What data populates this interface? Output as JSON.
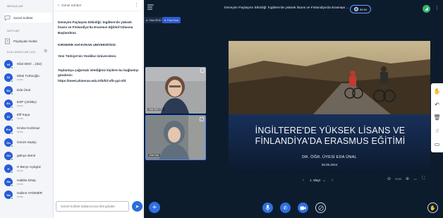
{
  "sidebar": {
    "messages_title": "MESAJLAR",
    "public_chat": "Genel Sohbet",
    "notes_title": "NOTLAR",
    "shared_notes": "Paylaşılan Notlar",
    "users_title": "KULLANICILAR (10)",
    "users": [
      {
        "initials": "Hi",
        "name": "Hilal SEKİ ...(Siz)",
        "sub": ""
      },
      {
        "initials": "Di",
        "name": "Dilek Tufracığlu",
        "sub": "MOBIL"
      },
      {
        "initials": "Ed",
        "name": "Eda Ünal",
        "sub": ""
      },
      {
        "initials": "Es",
        "name": "ESP Çimlökçi",
        "sub": "MOBIL"
      },
      {
        "initials": "El",
        "name": "Elif Kaya",
        "sub": "MOBIL"
      },
      {
        "initials": "Em",
        "name": "Emine Korkmaz",
        "sub": "MOBIL"
      },
      {
        "initials": "Gu",
        "name": "Gonze Saatçi",
        "sub": ""
      },
      {
        "initials": "Gü",
        "name": "gülnçe demir",
        "sub": ""
      },
      {
        "initials": "H",
        "name": "H Berçe Açıkgöz",
        "sub": "MOBIL"
      },
      {
        "initials": "Ha",
        "name": "Habibe Ertaş",
        "sub": "MOBIL"
      },
      {
        "initials": "Ha",
        "name": "Halime AYDEMİR",
        "sub": "MOBIL"
      }
    ]
  },
  "chat": {
    "title": "Genel Sohbet",
    "welcome_line1": "Deneyim Paylaşımı Etkinliği: İngiltere'de yüksek lisans ve Finlandiya'da Erasmus Eğitimi'Odasına Başlandınız.",
    "welcome_line2": "KIRSEHİR AHİ EVRAN UNİVERSİTESİ.",
    "welcome_line3": "Yeni Türkiye'nin Yenilikci Üniversitesi.",
    "invite_text": "Toplantıya çağırmak istediğiniz kişilere bu bağlantıyı gönderin:",
    "invite_link": "https://meet.ahievran.edu.tr/b/hil-ofb-ypi-ofd",
    "input_placeholder": "Genel Sohbet kullanıcısına ileti gönder"
  },
  "main": {
    "meeting_title": "Deneyim Paylaşımı Etkinliği: İngiltere'de yüksek lisans ve Finlandiya'da Erasmus ...",
    "recording_time": "00:34",
    "tag_host": "Hilal SEKİ ÖZ",
    "tag_presenter": "Eda Ünal",
    "tile1_label": "Hilal SEKİ ÖZ",
    "tile2_label": "Eda Ünal",
    "slide": {
      "title_line1": "İNGİLTERE'DE YÜKSEK LİSANS VE",
      "title_line2": "FİNLANDİYA'DA ERASMUS EĞİTİMİ",
      "author": "DR. ÖĞR. ÜYESİ EDA ÜNAL",
      "date": "28.05.2024"
    },
    "slide_counter": "1. Slayt",
    "zoom_level": "%100"
  },
  "colors": {
    "accent": "#2f6fe0",
    "sidebar_bg": "#f3f5f8",
    "main_bg": "#0d1c2d",
    "online": "#1eae5c"
  }
}
